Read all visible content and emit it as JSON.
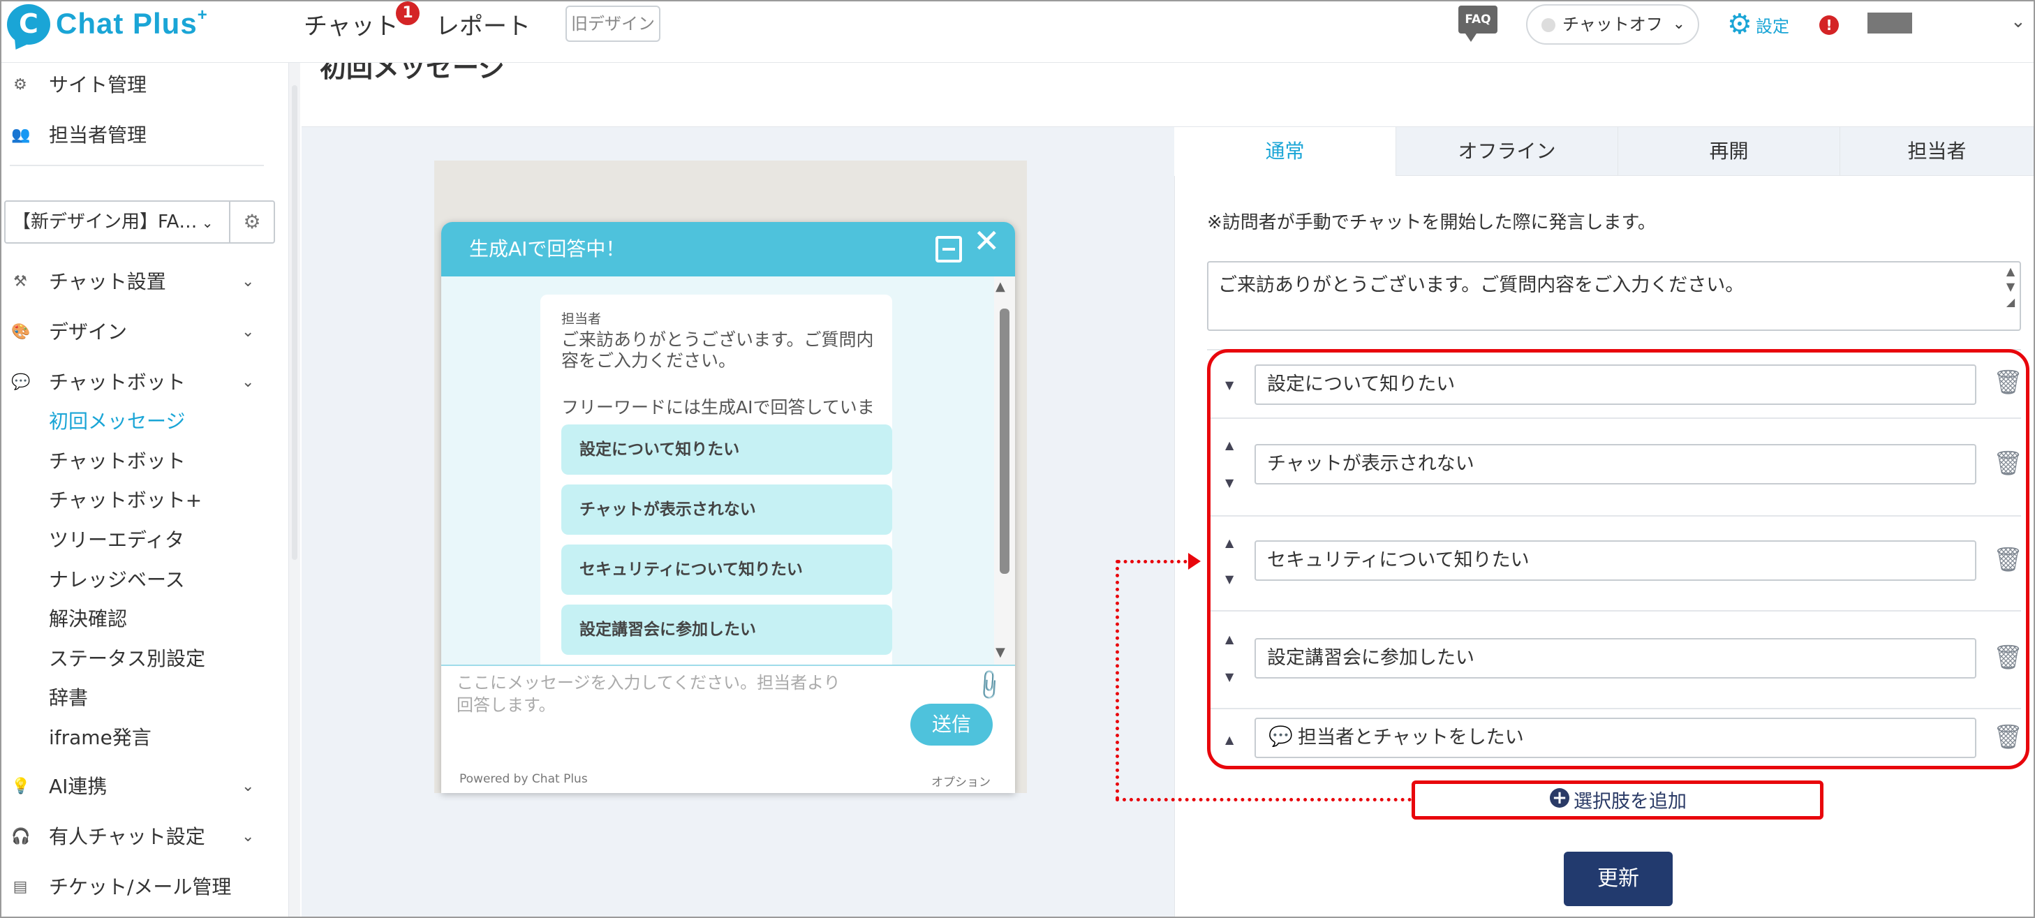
{
  "header": {
    "logo_text": "Chat Plus",
    "logo_sup": "+",
    "nav": [
      {
        "label": "チャット",
        "badge": "1"
      },
      {
        "label": "レポート"
      }
    ],
    "old_design_label": "旧デザイン",
    "faq_label": "FAQ",
    "chat_status": "チャットオフ",
    "settings_label": "設定"
  },
  "sidebar": {
    "top_items": [
      {
        "label": "サイト管理",
        "icon": "gears-icon"
      },
      {
        "label": "担当者管理",
        "icon": "users-icon"
      }
    ],
    "site_select": "【新デザイン用】FA…",
    "sections": [
      {
        "label": "チャット設置",
        "icon": "wrench-icon"
      },
      {
        "label": "デザイン",
        "icon": "palette-icon"
      },
      {
        "label": "チャットボット",
        "icon": "chat-icon"
      }
    ],
    "chatbot_sub_items": [
      "初回メッセージ",
      "チャットボット",
      "チャットボット+",
      "ツリーエディタ",
      "ナレッジベース",
      "解決確認",
      "ステータス別設定",
      "辞書",
      "iframe発言"
    ],
    "active_sub_item": "初回メッセージ",
    "bottom_sections": [
      {
        "label": "AI連携",
        "icon": "bulb-icon"
      },
      {
        "label": "有人チャット設定",
        "icon": "headset-icon"
      },
      {
        "label": "チケット/メール管理",
        "icon": "ticket-icon"
      }
    ]
  },
  "page": {
    "title": "初回メッセージ"
  },
  "preview": {
    "header_title": "生成AIで回答中！",
    "sender": "担当者",
    "message_line1": "ご来訪ありがとうございます。ご質問内容をご入力ください。",
    "message_line2": "フリーワードには生成AIで回答しています。",
    "choices": [
      "設定について知りたい",
      "チャットが表示されない",
      "セキュリティについて知りたい",
      "設定講習会に参加したい"
    ],
    "input_placeholder": "ここにメッセージを入力してください。担当者より回答します。",
    "send_label": "送信",
    "powered_by": "Powered by Chat Plus",
    "option_label": "オプション"
  },
  "panel": {
    "tabs": [
      "通常",
      "オフライン",
      "再開",
      "担当者"
    ],
    "active_tab": "通常",
    "note": "※訪問者が手動でチャットを開始した際に発言します。",
    "message_value": "ご来訪ありがとうございます。ご質問内容をご入力ください。",
    "choices": [
      "設定について知りたい",
      "チャットが表示されない",
      "セキュリティについて知りたい",
      "設定講習会に参加したい",
      "担当者とチャットをしたい"
    ],
    "add_choice_label": "選択肢を追加",
    "update_label": "更新"
  },
  "colors": {
    "accent": "#1aa5d6",
    "widget_header": "#4ec2dc",
    "choice_bg": "#c6f1f4",
    "highlight_red": "#e8060c",
    "update_button": "#223a6e"
  }
}
